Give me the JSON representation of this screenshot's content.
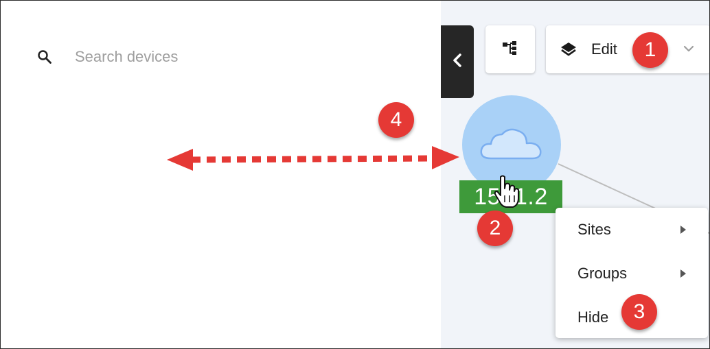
{
  "search": {
    "placeholder": "Search devices",
    "icon": "search-icon"
  },
  "sidebar_toggle": {
    "icon": "chevron-left-icon"
  },
  "toolbar": {
    "topology_icon": "topology-icon",
    "edit_label": "Edit",
    "edit_icon": "layers-icon",
    "dropdown_icon": "chevron-down-icon"
  },
  "node": {
    "label": "15 .1.2",
    "icon": "cloud-icon",
    "circle_color": "#a9d1f7",
    "label_color": "#3e9a3a"
  },
  "context_menu": {
    "items": [
      {
        "label": "Sites",
        "has_submenu": true
      },
      {
        "label": "Groups",
        "has_submenu": true
      },
      {
        "label": "Hide",
        "has_submenu": false
      }
    ]
  },
  "callouts": {
    "b1": "1",
    "b2": "2",
    "b3": "3",
    "b4": "4",
    "color": "#e53935"
  }
}
